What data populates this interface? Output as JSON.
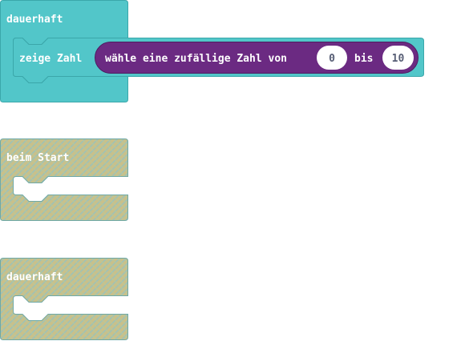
{
  "workspace": {
    "colors": {
      "basic_block": "#52c6c9",
      "basic_block_border": "#3ba7aa",
      "math_block": "#6b2a82",
      "math_block_border": "#4f1c61",
      "disabled_block": "#c9c08a",
      "disabled_pattern": "#9dc2b8",
      "number_field": "#ffffff",
      "number_text": "#575e75",
      "label_text": "#ffffff"
    },
    "forever_block": {
      "label": "dauerhaft",
      "statement": {
        "label": "zeige Zahl",
        "reporter": {
          "label_prefix": "wähle eine zufällige Zahl von",
          "from_value": "0",
          "label_middle": "bis",
          "to_value": "10"
        }
      }
    },
    "on_start_block_disabled": {
      "label": "beim Start"
    },
    "forever_block_disabled": {
      "label": "dauerhaft"
    }
  }
}
